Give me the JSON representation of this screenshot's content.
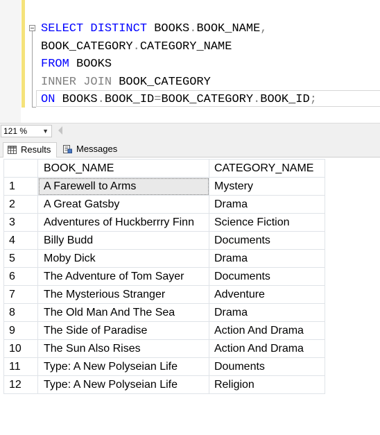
{
  "editor": {
    "lines": [
      [
        {
          "t": "SELECT DISTINCT ",
          "c": "kw"
        },
        {
          "t": "BOOKS",
          "c": "ident"
        },
        {
          "t": ".",
          "c": "gray"
        },
        {
          "t": "BOOK_NAME",
          "c": "ident"
        },
        {
          "t": ",",
          "c": "gray"
        }
      ],
      [
        {
          "t": "BOOK_CATEGORY",
          "c": "ident"
        },
        {
          "t": ".",
          "c": "gray"
        },
        {
          "t": "CATEGORY_NAME",
          "c": "ident"
        }
      ],
      [
        {
          "t": "FROM ",
          "c": "kw"
        },
        {
          "t": "BOOKS",
          "c": "ident"
        }
      ],
      [
        {
          "t": "INNER JOIN ",
          "c": "gray"
        },
        {
          "t": "BOOK_CATEGORY",
          "c": "ident"
        }
      ],
      [
        {
          "t": "ON ",
          "c": "kw"
        },
        {
          "t": "BOOKS",
          "c": "ident"
        },
        {
          "t": ".",
          "c": "gray"
        },
        {
          "t": "BOOK_ID",
          "c": "ident"
        },
        {
          "t": "=",
          "c": "gray"
        },
        {
          "t": "BOOK_CATEGORY",
          "c": "ident"
        },
        {
          "t": ".",
          "c": "gray"
        },
        {
          "t": "BOOK_ID",
          "c": "ident"
        },
        {
          "t": ";",
          "c": "gray"
        }
      ]
    ]
  },
  "zoom": {
    "value": "121 %"
  },
  "tabs": {
    "results_label": "Results",
    "messages_label": "Messages"
  },
  "grid": {
    "headers": [
      "BOOK_NAME",
      "CATEGORY_NAME"
    ],
    "rows": [
      {
        "num": "1",
        "book": "A Farewell to Arms",
        "category": "Mystery"
      },
      {
        "num": "2",
        "book": "A Great Gatsby",
        "category": "Drama"
      },
      {
        "num": "3",
        "book": "Adventures of Huckberrry Finn",
        "category": "Science Fiction"
      },
      {
        "num": "4",
        "book": "Billy Budd",
        "category": "Documents"
      },
      {
        "num": "5",
        "book": "Moby Dick",
        "category": "Drama"
      },
      {
        "num": "6",
        "book": "The Adventure of Tom Sayer",
        "category": "Documents"
      },
      {
        "num": "7",
        "book": "The Mysterious Stranger",
        "category": "Adventure"
      },
      {
        "num": "8",
        "book": "The Old Man And The Sea",
        "category": "Drama"
      },
      {
        "num": "9",
        "book": "The Side of Paradise",
        "category": "Action And Drama"
      },
      {
        "num": "10",
        "book": "The Sun Also Rises",
        "category": "Action And Drama"
      },
      {
        "num": "11",
        "book": "Type: A New Polyseian Life",
        "category": "Douments"
      },
      {
        "num": "12",
        "book": "Type: A New Polyseian Life",
        "category": "Religion"
      }
    ]
  },
  "colors": {
    "keyword": "#0000ff",
    "operator": "#808080",
    "changebar": "#f5e27a",
    "selected_cell": "#e9e9e9"
  },
  "icons": {
    "results": "grid-icon",
    "messages": "messages-icon",
    "outline": "collapse-icon"
  }
}
